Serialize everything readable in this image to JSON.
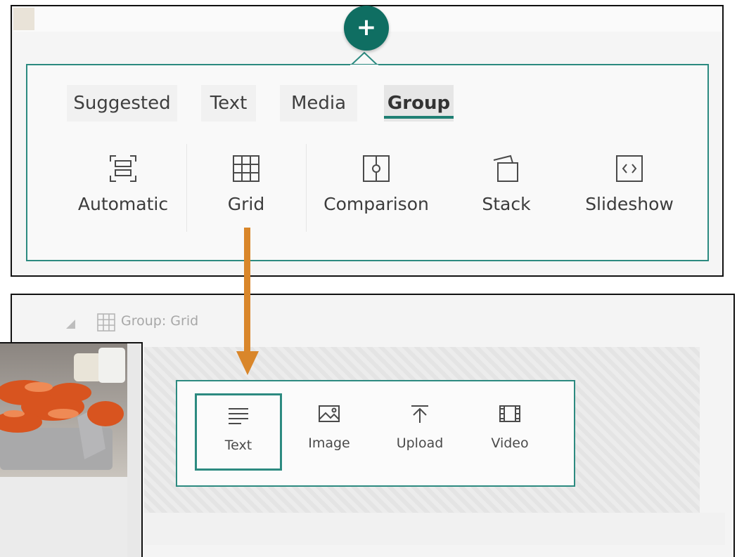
{
  "insert_panel": {
    "add_symbol": "+",
    "tabs": [
      {
        "label": "Suggested",
        "active": false
      },
      {
        "label": "Text",
        "active": false
      },
      {
        "label": "Media",
        "active": false
      },
      {
        "label": "Group",
        "active": true
      }
    ],
    "layouts": [
      {
        "label": "Automatic",
        "icon": "automatic-layout-icon"
      },
      {
        "label": "Grid",
        "icon": "grid-layout-icon"
      },
      {
        "label": "Comparison",
        "icon": "comparison-layout-icon"
      },
      {
        "label": "Stack",
        "icon": "stack-layout-icon"
      },
      {
        "label": "Slideshow",
        "icon": "slideshow-layout-icon"
      }
    ]
  },
  "group_section": {
    "header_label": "Group: Grid",
    "header_icon": "grid-icon",
    "collapse_icon": "collapse-triangle-icon",
    "content_options": [
      {
        "label": "Text",
        "icon": "text-lines-icon",
        "selected": true
      },
      {
        "label": "Image",
        "icon": "image-icon",
        "selected": false
      },
      {
        "label": "Upload",
        "icon": "upload-icon",
        "selected": false
      },
      {
        "label": "Video",
        "icon": "video-film-icon",
        "selected": false
      }
    ]
  },
  "colors": {
    "accent_teal": "#2c8a80",
    "add_button": "#0f6e62",
    "annotation_arrow": "#d9862a"
  }
}
